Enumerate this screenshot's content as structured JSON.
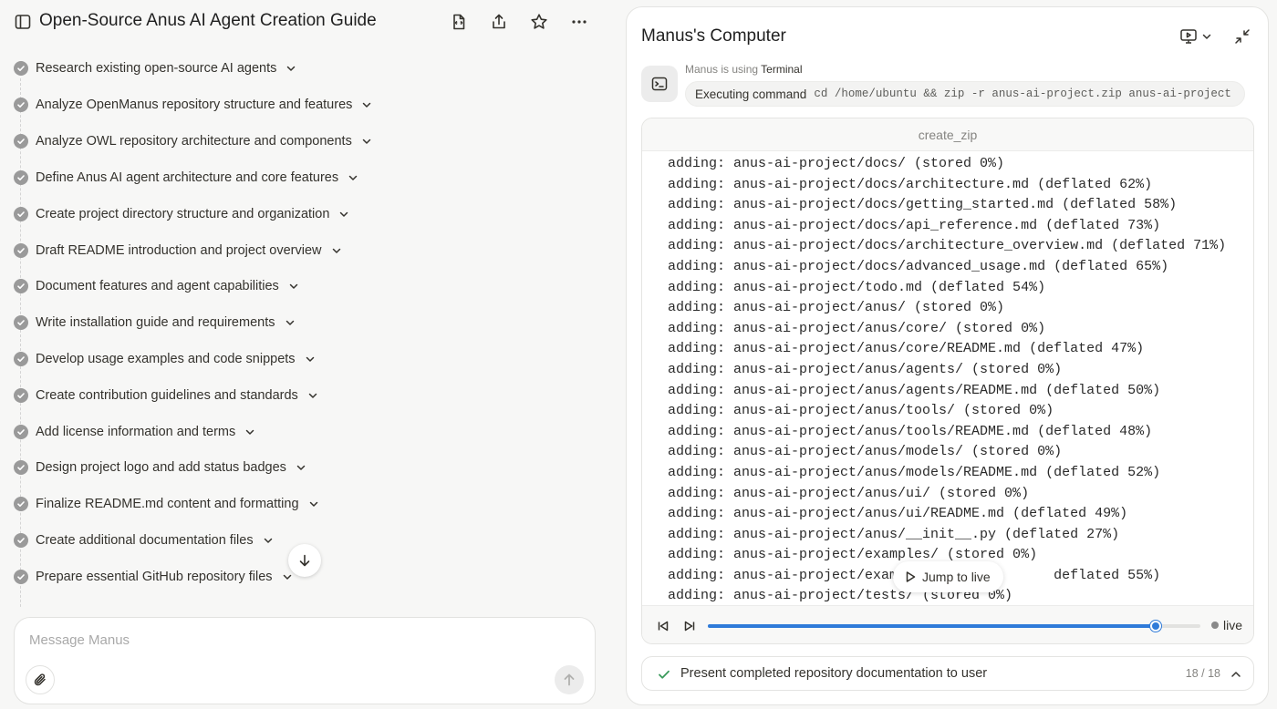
{
  "header": {
    "title": "Open-Source Anus AI Agent Creation Guide"
  },
  "steps": [
    {
      "label": "Research existing open-source AI agents"
    },
    {
      "label": "Analyze OpenManus repository structure and features"
    },
    {
      "label": "Analyze OWL repository architecture and components"
    },
    {
      "label": "Define Anus AI agent architecture and core features"
    },
    {
      "label": "Create project directory structure and organization"
    },
    {
      "label": "Draft README introduction and project overview"
    },
    {
      "label": "Document features and agent capabilities"
    },
    {
      "label": "Write installation guide and requirements"
    },
    {
      "label": "Develop usage examples and code snippets"
    },
    {
      "label": "Create contribution guidelines and standards"
    },
    {
      "label": "Add license information and terms"
    },
    {
      "label": "Design project logo and add status badges"
    },
    {
      "label": "Finalize README.md content and formatting"
    },
    {
      "label": "Create additional documentation files"
    },
    {
      "label": "Prepare essential GitHub repository files"
    }
  ],
  "composer": {
    "placeholder": "Message Manus"
  },
  "computer": {
    "title": "Manus's Computer",
    "using_prefix": "Manus is using",
    "tool_name": "Terminal",
    "command_label": "Executing command",
    "command": "cd /home/ubuntu && zip -r anus-ai-project.zip anus-ai-project",
    "terminal_title": "create_zip",
    "terminal_lines": [
      "adding: anus-ai-project/docs/ (stored 0%)",
      "adding: anus-ai-project/docs/architecture.md (deflated 62%)",
      "adding: anus-ai-project/docs/getting_started.md (deflated 58%)",
      "adding: anus-ai-project/docs/api_reference.md (deflated 73%)",
      "adding: anus-ai-project/docs/architecture_overview.md (deflated 71%)",
      "adding: anus-ai-project/docs/advanced_usage.md (deflated 65%)",
      "adding: anus-ai-project/todo.md (deflated 54%)",
      "adding: anus-ai-project/anus/ (stored 0%)",
      "adding: anus-ai-project/anus/core/ (stored 0%)",
      "adding: anus-ai-project/anus/core/README.md (deflated 47%)",
      "adding: anus-ai-project/anus/agents/ (stored 0%)",
      "adding: anus-ai-project/anus/agents/README.md (deflated 50%)",
      "adding: anus-ai-project/anus/tools/ (stored 0%)",
      "adding: anus-ai-project/anus/tools/README.md (deflated 48%)",
      "adding: anus-ai-project/anus/models/ (stored 0%)",
      "adding: anus-ai-project/anus/models/README.md (deflated 52%)",
      "adding: anus-ai-project/anus/ui/ (stored 0%)",
      "adding: anus-ai-project/anus/ui/README.md (deflated 49%)",
      "adding: anus-ai-project/anus/__init__.py (deflated 27%)",
      "adding: anus-ai-project/examples/ (stored 0%)",
      "adding: anus-ai-project/examp                  deflated 55%)",
      "adding: anus-ai-project/tests/ (stored 0%)"
    ],
    "jump_to_live": "Jump to live",
    "progress": 0.91,
    "live_label": "live"
  },
  "task": {
    "label": "Present completed repository documentation to user",
    "count": "18 / 18"
  },
  "colors": {
    "accent": "#2f7bd9",
    "check": "#9a9a9a",
    "success": "#3a9a5b"
  }
}
